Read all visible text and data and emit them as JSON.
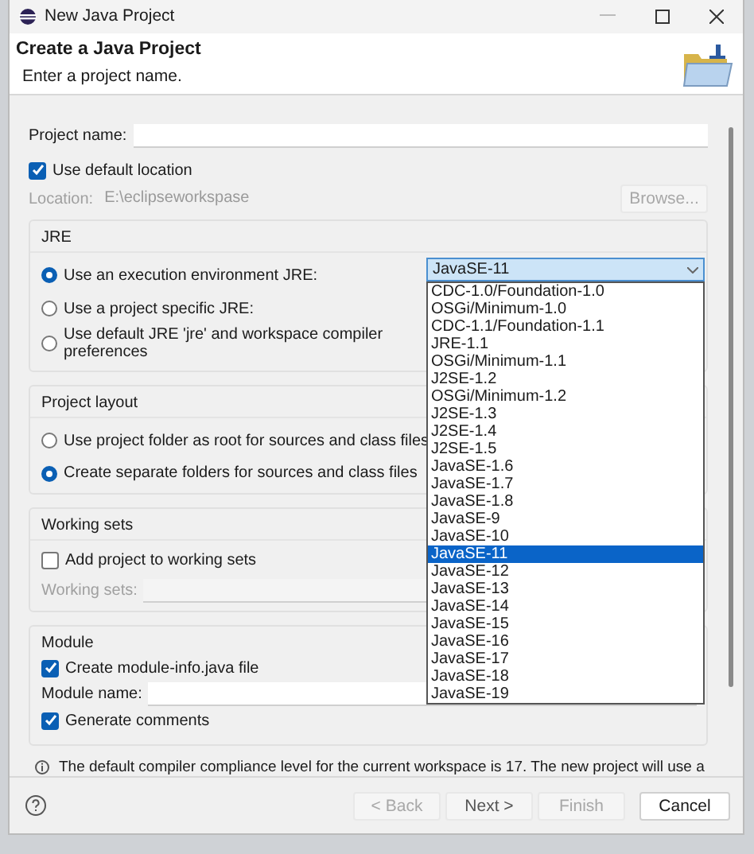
{
  "window": {
    "title": "New Java Project"
  },
  "header": {
    "title": "Create a Java Project",
    "subtitle": "Enter a project name."
  },
  "project_name": {
    "label": "Project name:"
  },
  "default_location": {
    "label": "Use default location",
    "checked": true
  },
  "location": {
    "label": "Location:",
    "value": "E:\\eclipseworkspase",
    "disabled": true
  },
  "browse_button": {
    "label": "Browse...",
    "disabled": true
  },
  "jre": {
    "title": "JRE",
    "options": [
      {
        "label": "Use an execution environment JRE:",
        "selected": true
      },
      {
        "label": "Use a project specific JRE:",
        "selected": false
      },
      {
        "label": "Use default JRE 'jre' and workspace compiler preferences",
        "selected": false
      }
    ],
    "combo_value": "JavaSE-11",
    "dropdown": [
      {
        "label": "CDC-1.0/Foundation-1.0",
        "selected": false
      },
      {
        "label": "OSGi/Minimum-1.0",
        "selected": false
      },
      {
        "label": "CDC-1.1/Foundation-1.1",
        "selected": false
      },
      {
        "label": "JRE-1.1",
        "selected": false
      },
      {
        "label": "OSGi/Minimum-1.1",
        "selected": false
      },
      {
        "label": "J2SE-1.2",
        "selected": false
      },
      {
        "label": "OSGi/Minimum-1.2",
        "selected": false
      },
      {
        "label": "J2SE-1.3",
        "selected": false
      },
      {
        "label": "J2SE-1.4",
        "selected": false
      },
      {
        "label": "J2SE-1.5",
        "selected": false
      },
      {
        "label": "JavaSE-1.6",
        "selected": false
      },
      {
        "label": "JavaSE-1.7",
        "selected": false
      },
      {
        "label": "JavaSE-1.8",
        "selected": false
      },
      {
        "label": "JavaSE-9",
        "selected": false
      },
      {
        "label": "JavaSE-10",
        "selected": false
      },
      {
        "label": "JavaSE-11",
        "selected": true
      },
      {
        "label": "JavaSE-12",
        "selected": false
      },
      {
        "label": "JavaSE-13",
        "selected": false
      },
      {
        "label": "JavaSE-14",
        "selected": false
      },
      {
        "label": "JavaSE-15",
        "selected": false
      },
      {
        "label": "JavaSE-16",
        "selected": false
      },
      {
        "label": "JavaSE-17",
        "selected": false
      },
      {
        "label": "JavaSE-18",
        "selected": false
      },
      {
        "label": "JavaSE-19",
        "selected": false
      }
    ]
  },
  "project_layout": {
    "title": "Project layout",
    "options": [
      {
        "label": "Use project folder as root for sources and class files",
        "selected": false
      },
      {
        "label": "Create separate folders for sources and class files",
        "selected": true
      }
    ]
  },
  "working_sets": {
    "title": "Working sets",
    "checkbox": {
      "label": "Add project to working sets",
      "checked": false
    },
    "field_label": "Working sets:",
    "disabled": true
  },
  "module": {
    "title": "Module",
    "create": {
      "label": "Create module-info.java file",
      "checked": true
    },
    "name_label": "Module name:",
    "comments": {
      "label": "Generate comments",
      "checked": true
    }
  },
  "info": "The default compiler compliance level for the current workspace is 17. The new project will use a",
  "buttons": [
    {
      "label": "< Back",
      "disabled": true,
      "kind": "nav"
    },
    {
      "label": "Next >",
      "disabled": false,
      "kind": "nav"
    },
    {
      "label": "Finish",
      "disabled": true,
      "kind": "nav"
    },
    {
      "label": "Cancel",
      "disabled": false,
      "kind": "primary"
    }
  ]
}
